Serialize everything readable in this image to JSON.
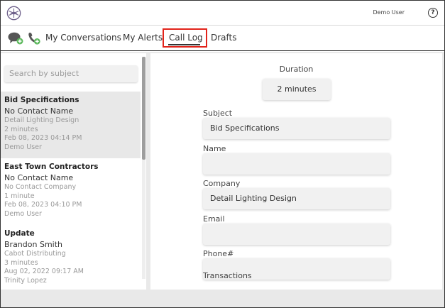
{
  "header": {
    "user_name": "Demo User",
    "help_label": "?"
  },
  "nav": {
    "items": [
      {
        "label": "My Conversations"
      },
      {
        "label": "My Alerts"
      },
      {
        "label": "Call Log"
      },
      {
        "label": "Drafts"
      }
    ],
    "active": "Call Log"
  },
  "search": {
    "placeholder": "Search by subject"
  },
  "calls": [
    {
      "subject": "Bid Specifications",
      "contact": "No Contact Name",
      "company": "Detail Lighting Design",
      "duration": "2 minutes",
      "datetime": "Feb 08, 2023 04:14 PM",
      "user": "Demo User",
      "selected": true
    },
    {
      "subject": "East Town Contractors",
      "contact": "No Contact Name",
      "company": "No Contact Company",
      "duration": "1 minute",
      "datetime": "Feb 08, 2023 04:10 PM",
      "user": "Demo User",
      "selected": false
    },
    {
      "subject": "Update",
      "contact": "Brandon Smith",
      "company": "Cabot Distributing",
      "duration": "3 minutes",
      "datetime": "Aug 02, 2022 09:17 AM",
      "user": "Trinity Lopez",
      "selected": false
    }
  ],
  "detail": {
    "duration_label": "Duration",
    "duration_value": "2 minutes",
    "fields": {
      "subject": {
        "label": "Subject",
        "value": "Bid Specifications"
      },
      "name": {
        "label": "Name",
        "value": ""
      },
      "company": {
        "label": "Company",
        "value": "Detail Lighting Design"
      },
      "email": {
        "label": "Email",
        "value": ""
      },
      "phone": {
        "label": "Phone#",
        "value": ""
      },
      "transactions": {
        "label": "Transactions"
      }
    }
  },
  "colors": {
    "active_highlight": "#e2231a",
    "chat_icon": "#555555",
    "plus_badge": "#5cb85c",
    "logo": "#6d5f8a"
  }
}
